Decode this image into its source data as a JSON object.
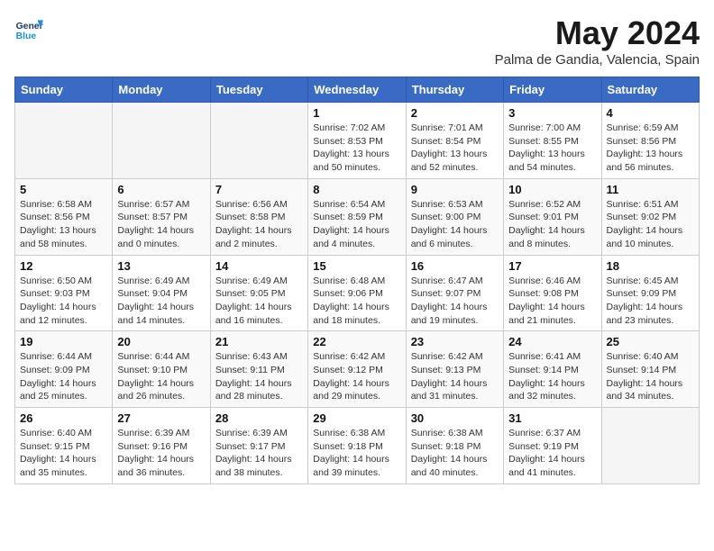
{
  "header": {
    "logo_line1": "General",
    "logo_line2": "Blue",
    "month": "May 2024",
    "location": "Palma de Gandia, Valencia, Spain"
  },
  "weekdays": [
    "Sunday",
    "Monday",
    "Tuesday",
    "Wednesday",
    "Thursday",
    "Friday",
    "Saturday"
  ],
  "weeks": [
    [
      {
        "day": "",
        "empty": true
      },
      {
        "day": "",
        "empty": true
      },
      {
        "day": "",
        "empty": true
      },
      {
        "day": "1",
        "sunrise": "7:02 AM",
        "sunset": "8:53 PM",
        "daylight": "13 hours and 50 minutes."
      },
      {
        "day": "2",
        "sunrise": "7:01 AM",
        "sunset": "8:54 PM",
        "daylight": "13 hours and 52 minutes."
      },
      {
        "day": "3",
        "sunrise": "7:00 AM",
        "sunset": "8:55 PM",
        "daylight": "13 hours and 54 minutes."
      },
      {
        "day": "4",
        "sunrise": "6:59 AM",
        "sunset": "8:56 PM",
        "daylight": "13 hours and 56 minutes."
      }
    ],
    [
      {
        "day": "5",
        "sunrise": "6:58 AM",
        "sunset": "8:56 PM",
        "daylight": "13 hours and 58 minutes."
      },
      {
        "day": "6",
        "sunrise": "6:57 AM",
        "sunset": "8:57 PM",
        "daylight": "14 hours and 0 minutes."
      },
      {
        "day": "7",
        "sunrise": "6:56 AM",
        "sunset": "8:58 PM",
        "daylight": "14 hours and 2 minutes."
      },
      {
        "day": "8",
        "sunrise": "6:54 AM",
        "sunset": "8:59 PM",
        "daylight": "14 hours and 4 minutes."
      },
      {
        "day": "9",
        "sunrise": "6:53 AM",
        "sunset": "9:00 PM",
        "daylight": "14 hours and 6 minutes."
      },
      {
        "day": "10",
        "sunrise": "6:52 AM",
        "sunset": "9:01 PM",
        "daylight": "14 hours and 8 minutes."
      },
      {
        "day": "11",
        "sunrise": "6:51 AM",
        "sunset": "9:02 PM",
        "daylight": "14 hours and 10 minutes."
      }
    ],
    [
      {
        "day": "12",
        "sunrise": "6:50 AM",
        "sunset": "9:03 PM",
        "daylight": "14 hours and 12 minutes."
      },
      {
        "day": "13",
        "sunrise": "6:49 AM",
        "sunset": "9:04 PM",
        "daylight": "14 hours and 14 minutes."
      },
      {
        "day": "14",
        "sunrise": "6:49 AM",
        "sunset": "9:05 PM",
        "daylight": "14 hours and 16 minutes."
      },
      {
        "day": "15",
        "sunrise": "6:48 AM",
        "sunset": "9:06 PM",
        "daylight": "14 hours and 18 minutes."
      },
      {
        "day": "16",
        "sunrise": "6:47 AM",
        "sunset": "9:07 PM",
        "daylight": "14 hours and 19 minutes."
      },
      {
        "day": "17",
        "sunrise": "6:46 AM",
        "sunset": "9:08 PM",
        "daylight": "14 hours and 21 minutes."
      },
      {
        "day": "18",
        "sunrise": "6:45 AM",
        "sunset": "9:09 PM",
        "daylight": "14 hours and 23 minutes."
      }
    ],
    [
      {
        "day": "19",
        "sunrise": "6:44 AM",
        "sunset": "9:09 PM",
        "daylight": "14 hours and 25 minutes."
      },
      {
        "day": "20",
        "sunrise": "6:44 AM",
        "sunset": "9:10 PM",
        "daylight": "14 hours and 26 minutes."
      },
      {
        "day": "21",
        "sunrise": "6:43 AM",
        "sunset": "9:11 PM",
        "daylight": "14 hours and 28 minutes."
      },
      {
        "day": "22",
        "sunrise": "6:42 AM",
        "sunset": "9:12 PM",
        "daylight": "14 hours and 29 minutes."
      },
      {
        "day": "23",
        "sunrise": "6:42 AM",
        "sunset": "9:13 PM",
        "daylight": "14 hours and 31 minutes."
      },
      {
        "day": "24",
        "sunrise": "6:41 AM",
        "sunset": "9:14 PM",
        "daylight": "14 hours and 32 minutes."
      },
      {
        "day": "25",
        "sunrise": "6:40 AM",
        "sunset": "9:14 PM",
        "daylight": "14 hours and 34 minutes."
      }
    ],
    [
      {
        "day": "26",
        "sunrise": "6:40 AM",
        "sunset": "9:15 PM",
        "daylight": "14 hours and 35 minutes."
      },
      {
        "day": "27",
        "sunrise": "6:39 AM",
        "sunset": "9:16 PM",
        "daylight": "14 hours and 36 minutes."
      },
      {
        "day": "28",
        "sunrise": "6:39 AM",
        "sunset": "9:17 PM",
        "daylight": "14 hours and 38 minutes."
      },
      {
        "day": "29",
        "sunrise": "6:38 AM",
        "sunset": "9:18 PM",
        "daylight": "14 hours and 39 minutes."
      },
      {
        "day": "30",
        "sunrise": "6:38 AM",
        "sunset": "9:18 PM",
        "daylight": "14 hours and 40 minutes."
      },
      {
        "day": "31",
        "sunrise": "6:37 AM",
        "sunset": "9:19 PM",
        "daylight": "14 hours and 41 minutes."
      },
      {
        "day": "",
        "empty": true
      }
    ]
  ]
}
